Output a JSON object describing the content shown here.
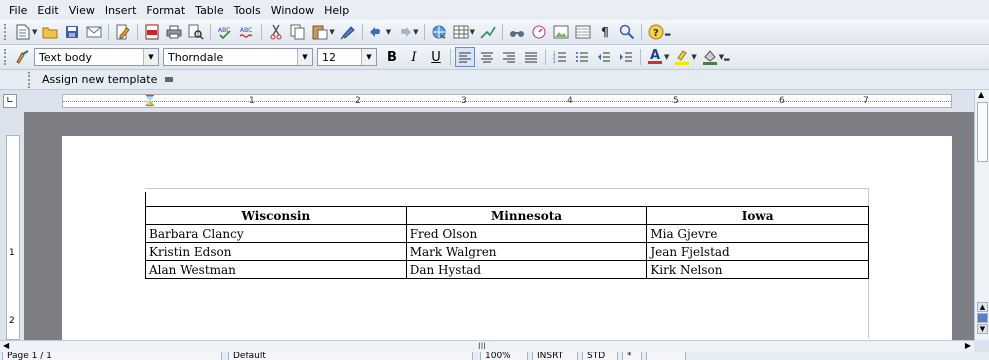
{
  "menu": [
    "File",
    "Edit",
    "View",
    "Insert",
    "Format",
    "Table",
    "Tools",
    "Window",
    "Help"
  ],
  "toolbar1": {
    "icons": [
      "new-icon",
      "open-icon",
      "save-icon",
      "email-icon",
      "edit-file-icon",
      "export-pdf-icon",
      "print-icon",
      "print-preview-icon",
      "spellcheck-icon",
      "autospell-icon",
      "cut-icon",
      "copy-icon",
      "paste-icon",
      "clone-format-icon",
      "undo-icon",
      "redo-icon",
      "hyperlink-icon",
      "table-icon",
      "draw-icon",
      "find-replace-icon",
      "navigator-icon",
      "gallery-icon",
      "data-sources-icon",
      "nonprinting-chars-icon",
      "zoom-icon",
      "help-icon"
    ]
  },
  "toolbar2": {
    "paragraph_style": "Text body",
    "font_name": "Thorndale",
    "font_size": "12",
    "bold": "B",
    "italic": "I",
    "underline": "U",
    "font_color": "A"
  },
  "toolbar3": {
    "assign_template_label": "Assign new template"
  },
  "ruler": {
    "marks": [
      "1",
      "2",
      "3",
      "4",
      "5",
      "6",
      "7"
    ],
    "vmarks": [
      "1",
      "2"
    ]
  },
  "table": {
    "headers": [
      "Wisconsin",
      "Minnesota",
      "Iowa"
    ],
    "rows": [
      [
        "Barbara Clancy",
        "Fred Olson",
        "Mia Gjevre"
      ],
      [
        "Kristin Edson",
        "Mark Walgren",
        "Jean Fjelstad"
      ],
      [
        "Alan Westman",
        "Dan Hystad",
        "Kirk Nelson"
      ]
    ]
  },
  "statusbar": {
    "page": "Page 1 / 1",
    "style": "Default",
    "zoom": "100%",
    "insert_mode": "INSRT",
    "selection_mode": "STD",
    "modified": "*"
  },
  "hscroll_grip": "III"
}
